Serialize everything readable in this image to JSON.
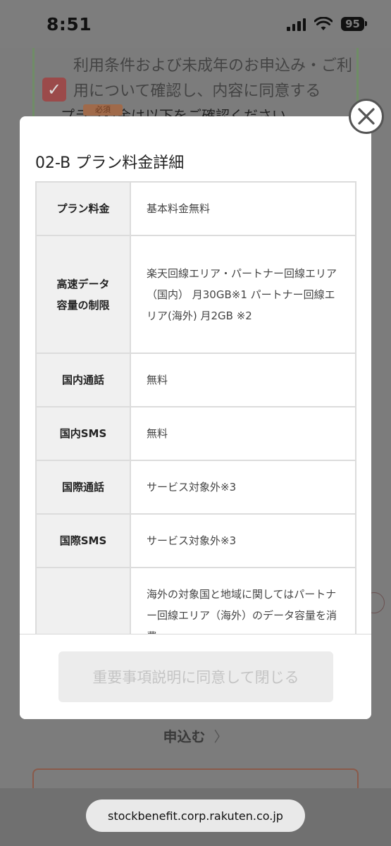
{
  "status_bar": {
    "time": "8:51",
    "battery": "95"
  },
  "background": {
    "terms_text": "利用条件および未成年のお申込み・ご利用について確認し、内容に同意する",
    "required_badge": "必須",
    "sub_text": "プラン料金は以下をご確認ください。",
    "apply_button": "申込む",
    "apply_chevron": "〉"
  },
  "modal": {
    "title": "02-B プラン料金詳細",
    "rows": [
      {
        "label": "プラン料金",
        "value": "基本料金無料"
      },
      {
        "label": "高速データ容量の制限",
        "value": "楽天回線エリア・パートナー回線エリア（国内） 月30GB※1 パートナー回線エリア(海外) 月2GB ※2"
      },
      {
        "label": "国内通話",
        "value": "無料"
      },
      {
        "label": "国内SMS",
        "value": "無料"
      },
      {
        "label": "国際通話",
        "value": "サービス対象外※3"
      },
      {
        "label": "国際SMS",
        "value": "サービス対象外※3"
      },
      {
        "label": "",
        "value": "海外の対象国と地域に関してはパートナー回線エリア（海外）のデータ容量を消費"
      }
    ],
    "agree_button": "重要事項説明に同意して閉じる"
  },
  "browser": {
    "url": "stockbenefit.corp.rakuten.co.jp"
  }
}
